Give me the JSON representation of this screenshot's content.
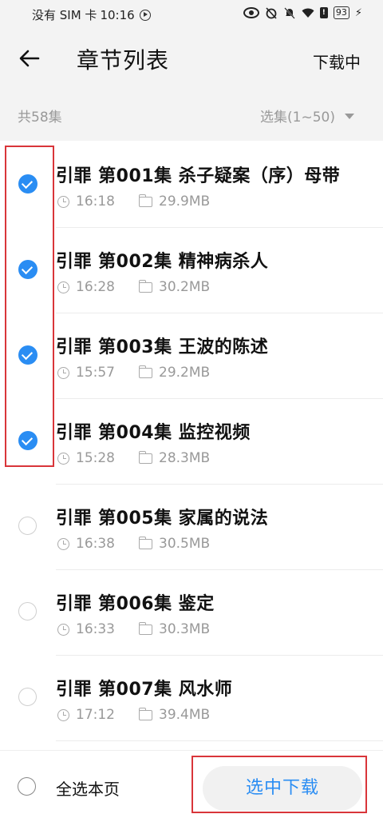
{
  "status_bar": {
    "carrier": "没有 SIM 卡",
    "time": "10:16",
    "battery": "93",
    "icons": [
      "eye-icon",
      "alarm-icon",
      "mute-bell-icon",
      "wifi-icon",
      "sim-alert-icon",
      "battery-icon",
      "charging-icon"
    ]
  },
  "header": {
    "title": "章节列表",
    "downloading_label": "下载中"
  },
  "subheader": {
    "count": "共58集",
    "range_label": "选集(1~50)"
  },
  "episodes": [
    {
      "title": "引罪  第001集  杀子疑案（序）母带",
      "duration": "16:18",
      "size": "29.9MB",
      "checked": true
    },
    {
      "title": "引罪  第002集  精神病杀人",
      "duration": "16:28",
      "size": "30.2MB",
      "checked": true
    },
    {
      "title": "引罪  第003集  王波的陈述",
      "duration": "15:57",
      "size": "29.2MB",
      "checked": true
    },
    {
      "title": "引罪  第004集  监控视频",
      "duration": "15:28",
      "size": "28.3MB",
      "checked": true
    },
    {
      "title": "引罪  第005集  家属的说法",
      "duration": "16:38",
      "size": "30.5MB",
      "checked": false
    },
    {
      "title": "引罪  第006集  鉴定",
      "duration": "16:33",
      "size": "30.3MB",
      "checked": false
    },
    {
      "title": "引罪  第007集  风水师",
      "duration": "17:12",
      "size": "39.4MB",
      "checked": false
    }
  ],
  "bottom_bar": {
    "select_all_label": "全选本页",
    "download_button": "选中下载"
  },
  "colors": {
    "accent": "#2a8df3",
    "highlight_box": "#d9353a"
  }
}
